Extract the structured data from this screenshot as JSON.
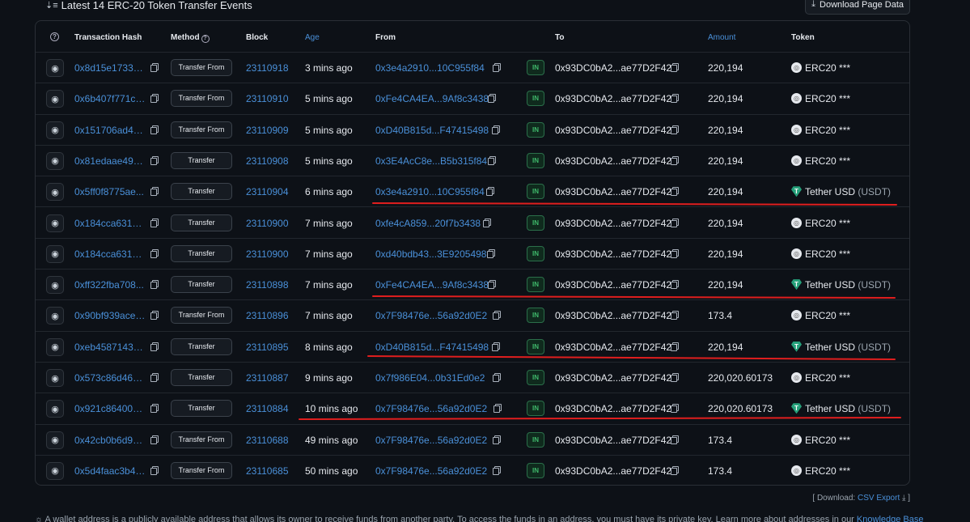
{
  "header": {
    "title": "Latest 14 ERC-20 Token Transfer Events",
    "download_label": "Download Page Data"
  },
  "columns": {
    "hash": "Transaction Hash",
    "method": "Method",
    "block": "Block",
    "age": "Age",
    "from": "From",
    "to": "To",
    "amount": "Amount",
    "token": "Token"
  },
  "rows": [
    {
      "hash": "0x8d15e1733fa...",
      "method": "Transfer From",
      "block": "23110918",
      "age": "3 mins ago",
      "from": "0x3e4a2910...10C955f84",
      "dir": "IN",
      "to": "0x93DC0bA2...ae77D2F42",
      "amount": "220,194",
      "token": "ERC20 ***",
      "sym": "",
      "usdt": false
    },
    {
      "hash": "0x6b407f771c1...",
      "method": "Transfer From",
      "block": "23110910",
      "age": "5 mins ago",
      "from": "0xFe4CA4EA...9Af8c3438",
      "dir": "IN",
      "to": "0x93DC0bA2...ae77D2F42",
      "amount": "220,194",
      "token": "ERC20 ***",
      "sym": "",
      "usdt": false
    },
    {
      "hash": "0x151706ad4c...",
      "method": "Transfer From",
      "block": "23110909",
      "age": "5 mins ago",
      "from": "0xD40B815d...F47415498",
      "dir": "IN",
      "to": "0x93DC0bA2...ae77D2F42",
      "amount": "220,194",
      "token": "ERC20 ***",
      "sym": "",
      "usdt": false
    },
    {
      "hash": "0x81edaae492...",
      "method": "Transfer",
      "block": "23110908",
      "age": "5 mins ago",
      "from": "0x3E4AcC8e...B5b315f84",
      "dir": "IN",
      "to": "0x93DC0bA2...ae77D2F42",
      "amount": "220,194",
      "token": "ERC20 ***",
      "sym": "",
      "usdt": false
    },
    {
      "hash": "0x5ff0f8775ae...",
      "method": "Transfer",
      "block": "23110904",
      "age": "6 mins ago",
      "from": "0x3e4a2910...10C955f84",
      "dir": "IN",
      "to": "0x93DC0bA2...ae77D2F42",
      "amount": "220,194",
      "token": "Tether USD",
      "sym": "(USDT)",
      "usdt": true
    },
    {
      "hash": "0x184cca631a...",
      "method": "Transfer",
      "block": "23110900",
      "age": "7 mins ago",
      "from": "0xfe4cA859...20f7b3438",
      "dir": "IN",
      "to": "0x93DC0bA2...ae77D2F42",
      "amount": "220,194",
      "token": "ERC20 ***",
      "sym": "",
      "usdt": false
    },
    {
      "hash": "0x184cca631a...",
      "method": "Transfer",
      "block": "23110900",
      "age": "7 mins ago",
      "from": "0xd40bdb43...3E9205498",
      "dir": "IN",
      "to": "0x93DC0bA2...ae77D2F42",
      "amount": "220,194",
      "token": "ERC20 ***",
      "sym": "",
      "usdt": false
    },
    {
      "hash": "0xff322fba708...",
      "method": "Transfer",
      "block": "23110898",
      "age": "7 mins ago",
      "from": "0xFe4CA4EA...9Af8c3438",
      "dir": "IN",
      "to": "0x93DC0bA2...ae77D2F42",
      "amount": "220,194",
      "token": "Tether USD",
      "sym": "(USDT)",
      "usdt": true
    },
    {
      "hash": "0x90bf939acef...",
      "method": "Transfer From",
      "block": "23110896",
      "age": "7 mins ago",
      "from": "0x7F98476e...56a92d0E2",
      "dir": "IN",
      "to": "0x93DC0bA2...ae77D2F42",
      "amount": "173.4",
      "token": "ERC20 ***",
      "sym": "",
      "usdt": false
    },
    {
      "hash": "0xeb4587143e...",
      "method": "Transfer",
      "block": "23110895",
      "age": "8 mins ago",
      "from": "0xD40B815d...F47415498",
      "dir": "IN",
      "to": "0x93DC0bA2...ae77D2F42",
      "amount": "220,194",
      "token": "Tether USD",
      "sym": "(USDT)",
      "usdt": true
    },
    {
      "hash": "0x573c86d464f...",
      "method": "Transfer",
      "block": "23110887",
      "age": "9 mins ago",
      "from": "0x7f986E04...0b31Ed0e2",
      "dir": "IN",
      "to": "0x93DC0bA2...ae77D2F42",
      "amount": "220,020.60173",
      "token": "ERC20 ***",
      "sym": "",
      "usdt": false
    },
    {
      "hash": "0x921c86400c...",
      "method": "Transfer",
      "block": "23110884",
      "age": "10 mins ago",
      "from": "0x7F98476e...56a92d0E2",
      "dir": "IN",
      "to": "0x93DC0bA2...ae77D2F42",
      "amount": "220,020.60173",
      "token": "Tether USD",
      "sym": "(USDT)",
      "usdt": true
    },
    {
      "hash": "0x42cb0b6d96...",
      "method": "Transfer From",
      "block": "23110688",
      "age": "49 mins ago",
      "from": "0x7F98476e...56a92d0E2",
      "dir": "IN",
      "to": "0x93DC0bA2...ae77D2F42",
      "amount": "173.4",
      "token": "ERC20 ***",
      "sym": "",
      "usdt": false
    },
    {
      "hash": "0x5d4faac3b4f...",
      "method": "Transfer From",
      "block": "23110685",
      "age": "50 mins ago",
      "from": "0x7F98476e...56a92d0E2",
      "dir": "IN",
      "to": "0x93DC0bA2...ae77D2F42",
      "amount": "173.4",
      "token": "ERC20 ***",
      "sym": "",
      "usdt": false
    }
  ],
  "footer": {
    "download_prefix": "[ Download:",
    "csv_label": "CSV Export",
    "download_suffix": "]",
    "note": "A wallet address is a publicly available address that allows its owner to receive funds from another party. To access the funds in an address, you must have its private key. Learn more about addresses in our",
    "kb_link": "Knowledge Base"
  },
  "colors": {
    "accent": "#4a90d9",
    "annotation": "#e01e1e",
    "in_badge": "#3fb96b",
    "usdt": "#26a17b"
  }
}
